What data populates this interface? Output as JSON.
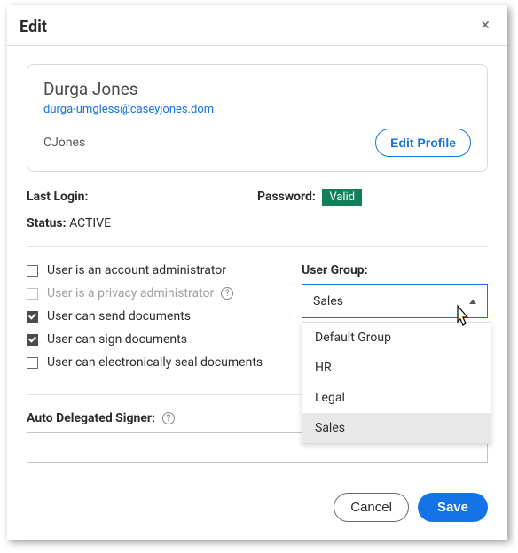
{
  "header": {
    "title": "Edit"
  },
  "card": {
    "name": "Durga Jones",
    "email": "durga-umgless@caseyjones.dom",
    "username": "CJones",
    "edit_profile": "Edit Profile"
  },
  "meta": {
    "last_login_label": "Last Login:",
    "password_label": "Password:",
    "password_status": "Valid",
    "status_label": "Status:",
    "status_value": "ACTIVE"
  },
  "checks": {
    "admin": "User is an account administrator",
    "privacy": "User is a privacy administrator",
    "send": "User can send documents",
    "sign": "User can sign documents",
    "seal": "User can electronically seal documents"
  },
  "group": {
    "label": "User Group:",
    "selected": "Sales",
    "options": [
      "Default Group",
      "HR",
      "Legal",
      "Sales"
    ]
  },
  "auto": {
    "label": "Auto Delegated Signer:",
    "value": ""
  },
  "footer": {
    "cancel": "Cancel",
    "save": "Save"
  }
}
